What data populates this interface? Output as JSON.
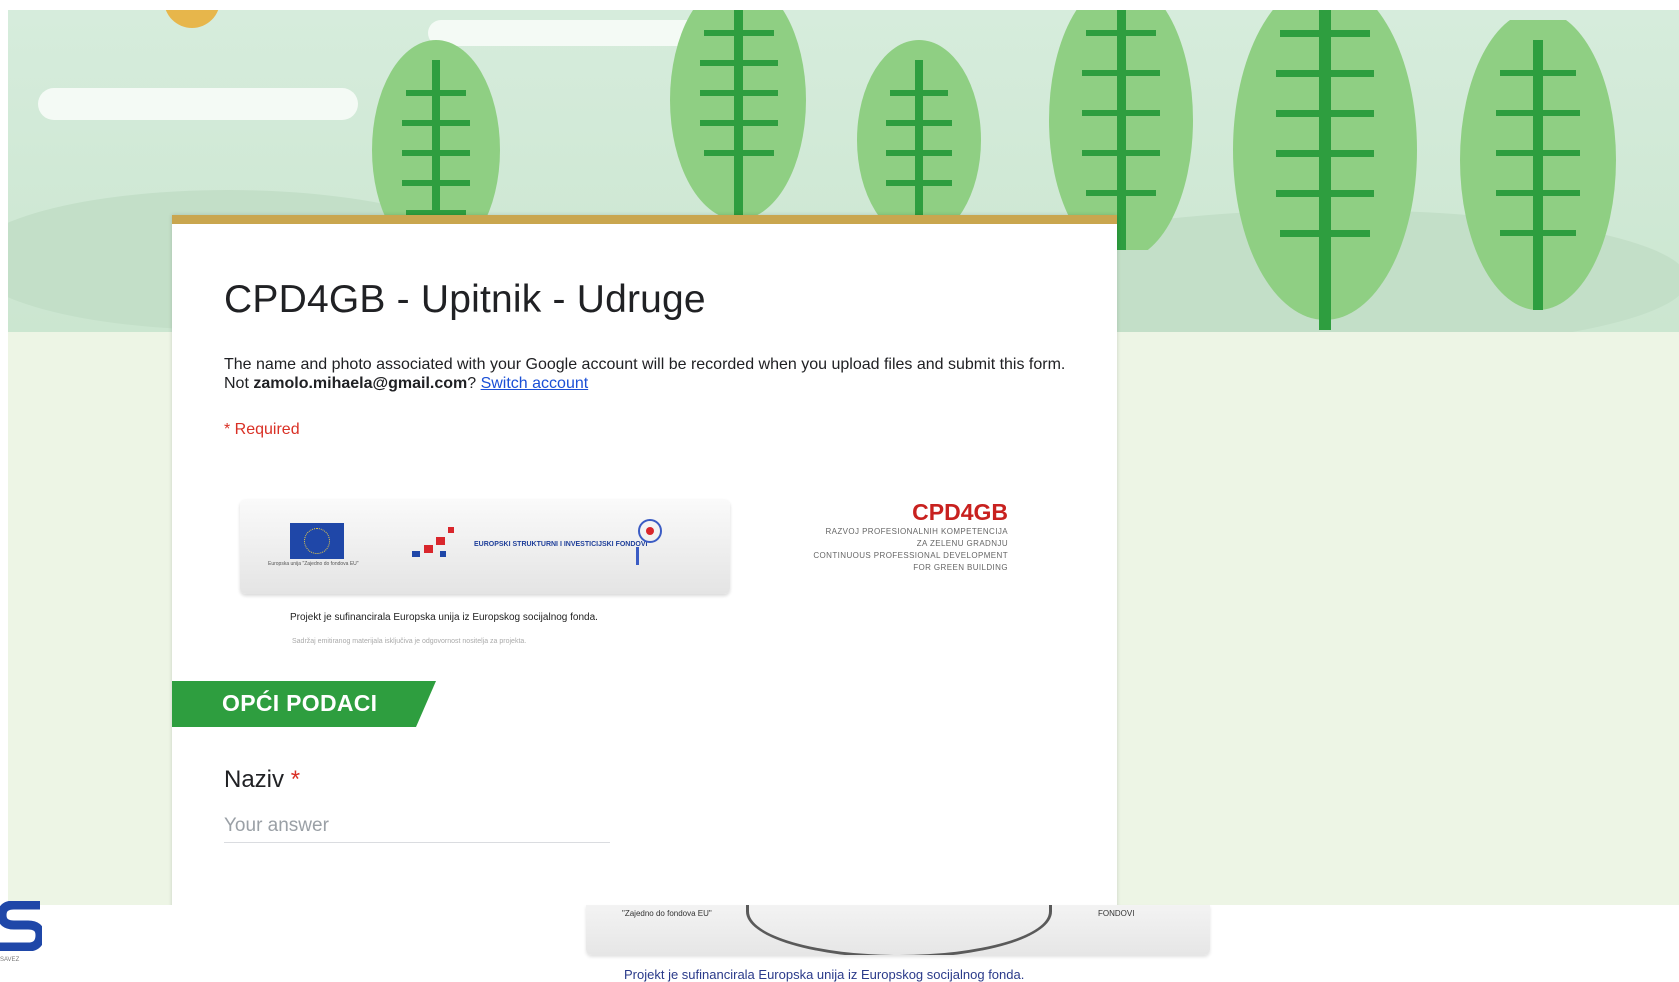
{
  "form": {
    "title": "CPD4GB - Upitnik - Udruge",
    "description_pre": "The name and photo associated with your Google account will be recorded when you upload files and submit this form. Not ",
    "account_email": "zamolo.mihaela@gmail.com",
    "description_mid": "? ",
    "switch_account": "Switch account",
    "required_note": "* Required"
  },
  "banner": {
    "eu_caption": "Europska unija \"Zajedno do fondova EU\"",
    "esif_text": "EUROPSKI STRUKTURNI I INVESTICIJSKI FONDOVI",
    "project_caption": "Projekt je sufinancirala Europska unija iz Europskog socijalnog fonda.",
    "disclaimer": "Sadržaj emitiranog materijala isključiva je odgovornost nositelja za projekta."
  },
  "brand": {
    "name": "CPD4GB",
    "lines": [
      "RAZVOJ PROFESIONALNIH KOMPETENCIJA",
      "ZA ZELENU GRADNJU",
      "CONTINUOUS PROFESSIONAL DEVELOPMENT",
      "FOR GREEN BUILDING"
    ]
  },
  "section": {
    "title": "OPĆI PODACI"
  },
  "question": {
    "label": "Naziv",
    "required_mark": "*",
    "placeholder": "Your answer"
  },
  "below": {
    "logo_text": "SAVEZ",
    "banner_left": "\"Zajedno do fondova EU\"",
    "banner_right": "FONDOVI",
    "caption": "Projekt je sufinancirala Europska unija iz Europskog socijalnog fonda."
  },
  "colors": {
    "accent_border": "#c9a64f",
    "section_green": "#2e9e3f",
    "required_red": "#d93025",
    "link_blue": "#1a4fd6",
    "brand_red": "#c8211f"
  }
}
